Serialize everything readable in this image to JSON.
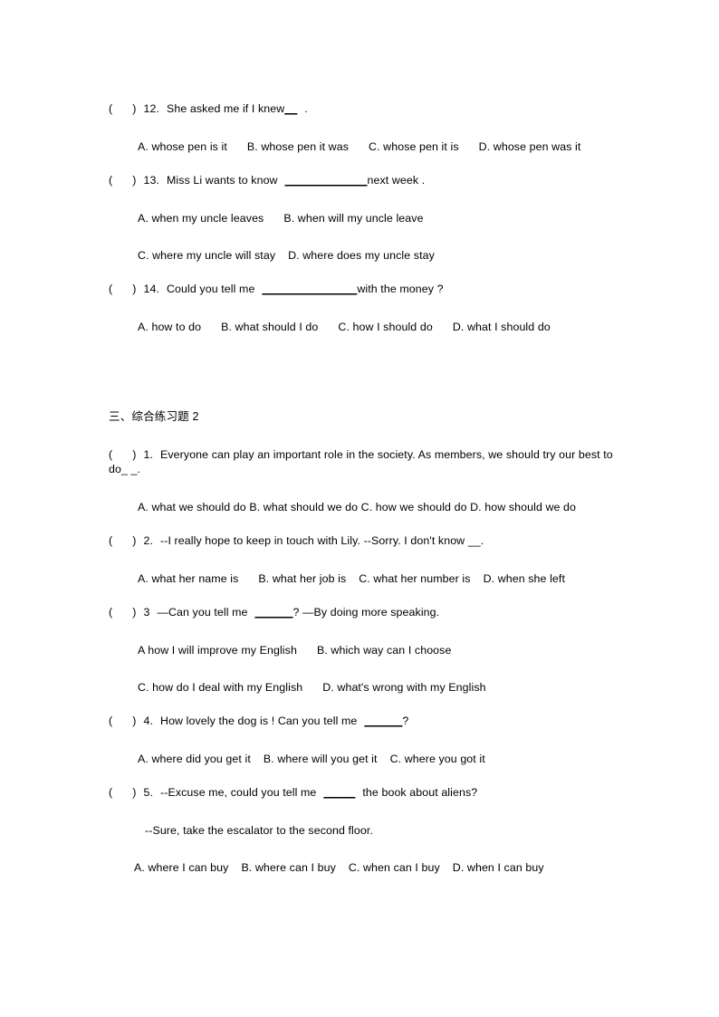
{
  "document": {
    "page_size": "A4",
    "background_color": "#ffffff",
    "text_color": "#000000",
    "language": "zh-CN + en"
  },
  "section_one": {
    "questions": [
      {
        "marker": "(",
        "marker_close": ")",
        "number": "12.",
        "stem": "She asked me if I knew",
        "blank": "__",
        "stem_tail": ".",
        "options_rows": [
          {
            "options": [
              "A. whose pen is it",
              "B. whose pen it was",
              "C. whose pen it is",
              "D. whose pen was it"
            ]
          }
        ]
      },
      {
        "marker": "(",
        "marker_close": ")",
        "number": "13.",
        "stem": "Miss Li wants to know",
        "blank": "_____________",
        "stem_tail": "next week .",
        "options_rows": [
          {
            "options": [
              "A. when my uncle leaves",
              "B. when will my uncle leave"
            ]
          },
          {
            "options": [
              "C. where my uncle will stay",
              "D. where does my uncle stay"
            ]
          }
        ]
      },
      {
        "marker": "(",
        "marker_close": ")",
        "number": "14.",
        "stem": "Could you tell me",
        "blank": "_______________",
        "stem_tail": "with the money ?",
        "options_rows": [
          {
            "options": [
              "A. how to do",
              "B. what should I do",
              "C. how I should do",
              "D. what I should do"
            ]
          }
        ]
      }
    ]
  },
  "section_two": {
    "heading": "三、综合练习题 2",
    "questions": [
      {
        "marker": "(",
        "marker_close": ")",
        "number": "1.",
        "stem_full": "Everyone can play an important role in the society. As members, we should try our best to do_   _.",
        "options_full": "A. what we should  do   B. what should  we do   C. how we should  do   D. how should  we do"
      },
      {
        "marker": "(",
        "marker_close": ")",
        "number": "2.",
        "stem_full": "--I really hope to keep in touch with Lily.    --Sorry. I don't know __.",
        "options_rows": [
          {
            "options": [
              "A. what her name is",
              "B. what her job is",
              "C. what her number is",
              "D. when she left"
            ]
          }
        ]
      },
      {
        "marker": "(",
        "marker_close": ")",
        "number": "3",
        "stem_pre": "—Can you tell me",
        "blank": "______",
        "stem_tail": "?    —By doing more speaking.",
        "options_rows": [
          {
            "options": [
              "A how I will improve my English",
              "B. which way can I choose"
            ]
          },
          {
            "options": [
              "C. how do I deal with my English",
              "D. what's wrong with my English"
            ]
          }
        ]
      },
      {
        "marker": "(",
        "marker_close": ")",
        "number": "4.",
        "stem_pre": "How lovely the dog is ! Can you tell me",
        "blank": "______",
        "stem_tail": "?",
        "options_rows": [
          {
            "options": [
              "A. where did you get it",
              "B. where will you get it",
              "C. where you got it"
            ]
          }
        ]
      },
      {
        "marker": "(",
        "marker_close": ")",
        "number": "5.",
        "stem_pre": "--Excuse me, could you tell me",
        "blank": "_____",
        "stem_tail": "the book about aliens?",
        "answer_line": "--Sure, take the escalator to the second floor.",
        "options_rows": [
          {
            "options": [
              "A. where I can buy",
              "B. where can I buy",
              "C. when can I buy",
              "D. when I can buy"
            ]
          }
        ]
      }
    ]
  }
}
